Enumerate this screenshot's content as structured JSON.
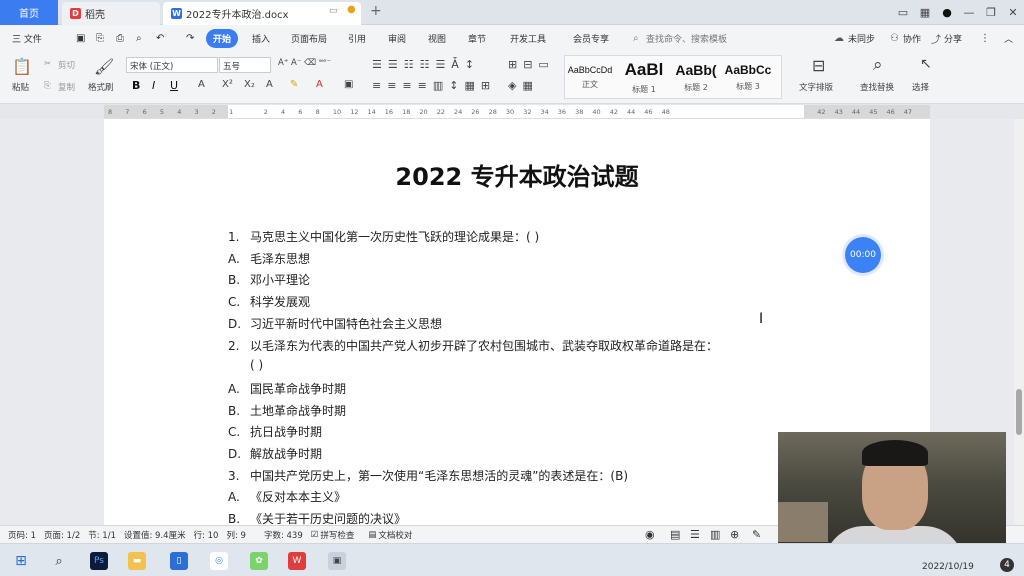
{
  "titlebar": {
    "home_tab": "首页",
    "tab1": "稻壳",
    "tab2": "2022专升本政治.docx",
    "new_tab": "+"
  },
  "menu": {
    "file": "三 文件",
    "items": [
      "开始",
      "插入",
      "页面布局",
      "引用",
      "审阅",
      "视图",
      "章节",
      "开发工具",
      "会员专享"
    ],
    "search_placeholder": "查找命令、搜索模板",
    "sync": "未同步",
    "collab": "协作",
    "share": "分享"
  },
  "ribbon": {
    "cut": "剪切",
    "copy": "复制",
    "paste": "粘贴",
    "format_painter": "格式刷",
    "font_name": "宋体 (正文)",
    "font_size": "五号",
    "styles": [
      {
        "preview": "AaBbCcDd",
        "label": "正文"
      },
      {
        "preview": "AaBl",
        "label": "标题 1"
      },
      {
        "preview": "AaBb(",
        "label": "标题 2"
      },
      {
        "preview": "AaBbCc",
        "label": "标题 3"
      }
    ],
    "text_layout": "文字排版",
    "find_replace": "查找替换",
    "select": "选择"
  },
  "ruler": {
    "ticks": [
      "8",
      "7",
      "6",
      "5",
      "4",
      "3",
      "2",
      "1",
      "",
      "2",
      "4",
      "6",
      "8",
      "10",
      "12",
      "14",
      "16",
      "18",
      "20",
      "22",
      "24",
      "26",
      "28",
      "30",
      "32",
      "34",
      "36",
      "38",
      "40",
      "42",
      "44",
      "46",
      "48",
      "",
      "",
      "",
      "",
      "",
      "",
      "",
      "",
      "42",
      "43",
      "44",
      "45",
      "46",
      "47"
    ]
  },
  "document": {
    "title": "2022 专升本政治试题",
    "lines": [
      {
        "num": "1.",
        "text": "马克思主义中国化第一次历史性飞跃的理论成果是：( )"
      },
      {
        "num": "A.",
        "text": "毛泽东思想"
      },
      {
        "num": "B.",
        "text": "邓小平理论"
      },
      {
        "num": "C.",
        "text": "科学发展观"
      },
      {
        "num": "D.",
        "text": "习近平新时代中国特色社会主义思想"
      },
      {
        "num": "2.",
        "text": "以毛泽东为代表的中国共产党人初步开辟了农村包围城市、武装夺取政权革命道路是在："
      },
      {
        "num": "",
        "text": "( )"
      },
      {
        "num": "A.",
        "text": "国民革命战争时期"
      },
      {
        "num": "B.",
        "text": "土地革命战争时期"
      },
      {
        "num": "C.",
        "text": "抗日战争时期"
      },
      {
        "num": "D.",
        "text": "解放战争时期"
      },
      {
        "num": "3.",
        "text": "中国共产党历史上，第一次使用“毛泽东思想活的灵魂”的表述是在：(B)"
      },
      {
        "num": "A.",
        "text": "《反对本本主义》"
      },
      {
        "num": "B.",
        "text": "《关于若干历史问题的决议》"
      }
    ]
  },
  "timer": "00:00",
  "status": {
    "page_num": "页码: 1",
    "pages": "页面: 1/2",
    "section": "节: 1/1",
    "setting": "设置值: 9.4厘米",
    "row": "行: 10",
    "col": "列: 9",
    "words": "字数: 439",
    "spell": "拼写检查",
    "proof": "文档校对"
  },
  "taskbar": {
    "date": "2022/10/19",
    "notif": "4"
  }
}
